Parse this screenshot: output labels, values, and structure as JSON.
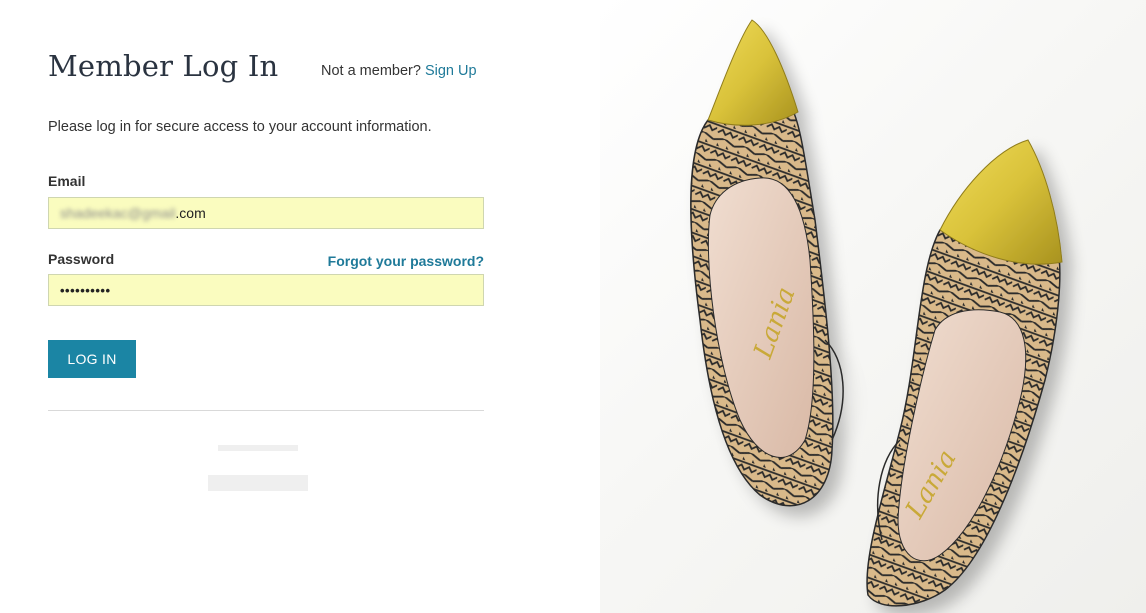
{
  "login": {
    "title": "Member Log In",
    "signup_prompt": "Not a member?",
    "signup_link": "Sign Up",
    "intro": "Please log in for secure access to your account information.",
    "email_label": "Email",
    "email_value_hidden": "shadeekac@gmail",
    "email_value_suffix": ".com",
    "password_label": "Password",
    "forgot_link": "Forgot your password?",
    "password_value": "••••••••••",
    "login_button": "LOG IN"
  },
  "hero": {
    "brand_script": "Lania",
    "colors": {
      "toe_gold": "#d9c23a",
      "pattern_tan": "#d9b98a",
      "pattern_ink": "#2a2a2a",
      "lining": "#e8cfc0",
      "accent": "#1b85a4"
    }
  }
}
